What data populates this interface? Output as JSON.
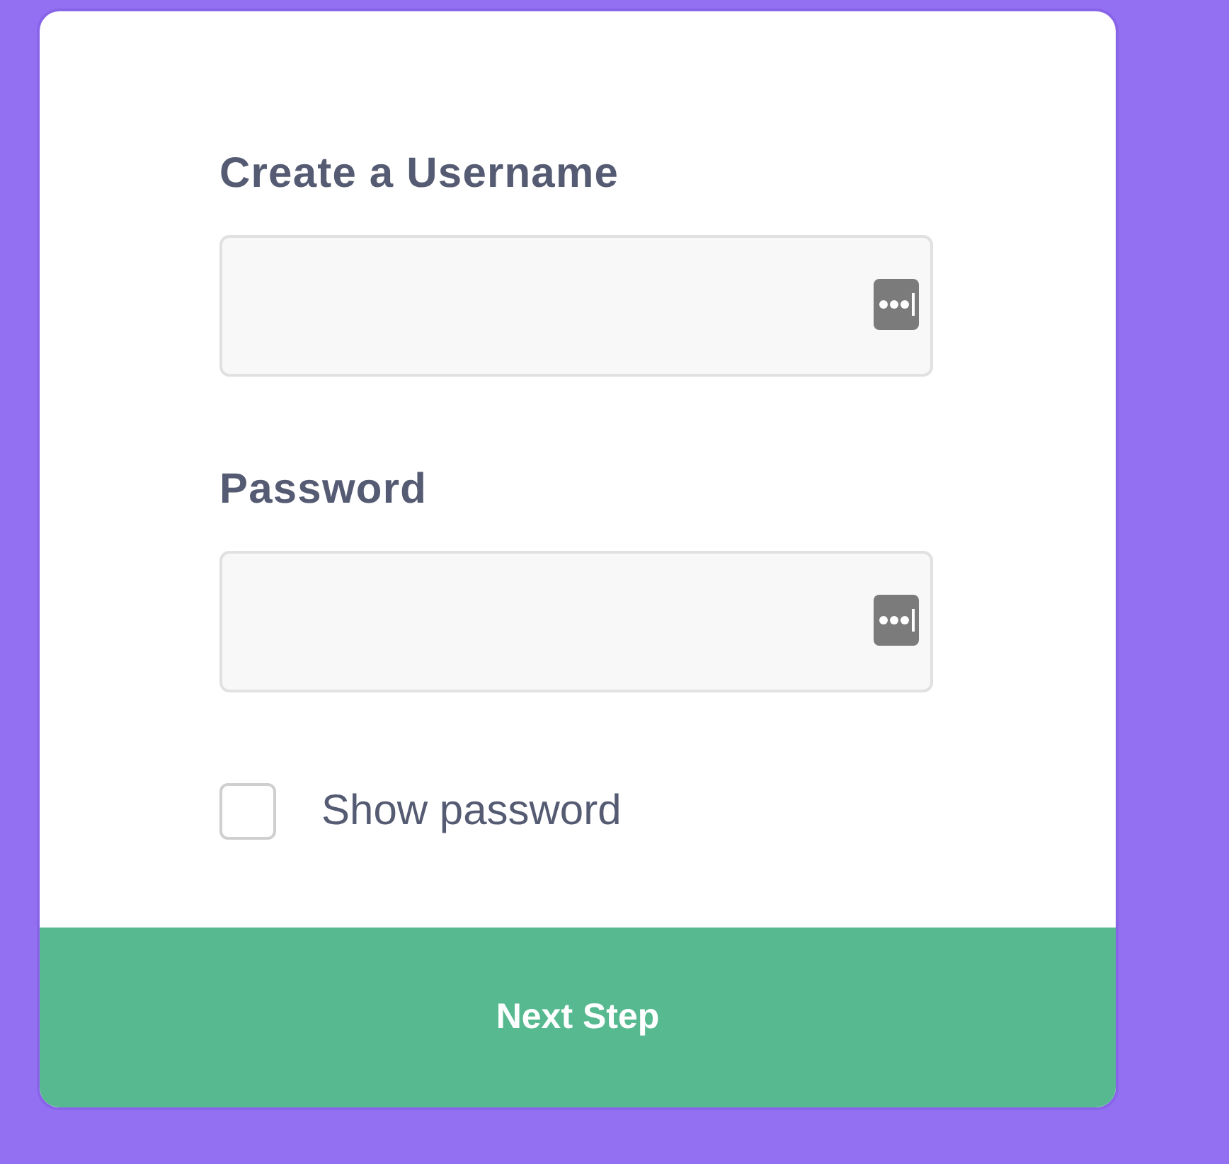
{
  "fields": [
    {
      "label": "Create a Username"
    },
    {
      "label": "Password"
    }
  ],
  "checkbox": {
    "label": "Show password",
    "checked": false
  },
  "button": {
    "label": "Next Step"
  }
}
